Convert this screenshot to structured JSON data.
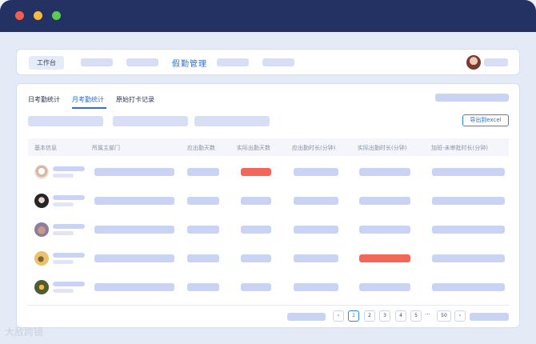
{
  "window": {
    "controls": [
      "close-dot",
      "minimize-dot",
      "maximize-dot"
    ]
  },
  "topnav": {
    "workspace_tag": "工作台",
    "active_item": "假勤管理"
  },
  "tabs": [
    "日考勤统计",
    "月考勤统计",
    "原始打卡记录"
  ],
  "active_tab_index": 1,
  "export_button": "导出到excel",
  "table": {
    "headers": [
      "基本信息",
      "所属主部门",
      "应出勤天数",
      "实际出勤天数",
      "应出勤时长(分钟)",
      "实际出勤时长(分钟)",
      "加班-未审批时长(分钟)"
    ],
    "rows": [
      {
        "avatar": "avatar-1",
        "highlight_col": 3
      },
      {
        "avatar": "avatar-2",
        "highlight_col": null
      },
      {
        "avatar": "avatar-3",
        "highlight_col": null
      },
      {
        "avatar": "avatar-4",
        "highlight_col": 5
      },
      {
        "avatar": "avatar-5",
        "highlight_col": null
      }
    ]
  },
  "pagination": {
    "prev": "‹",
    "pages": [
      "1",
      "2",
      "3",
      "4",
      "5"
    ],
    "ellipsis": "···",
    "last": "50",
    "next": "›",
    "current": "1"
  },
  "watermark": "大敌跨镜",
  "colors": {
    "titlebar": "#243163",
    "accent": "#2d6fd3",
    "highlight": "#f1685a",
    "placeholder": "#c9d3f4"
  }
}
